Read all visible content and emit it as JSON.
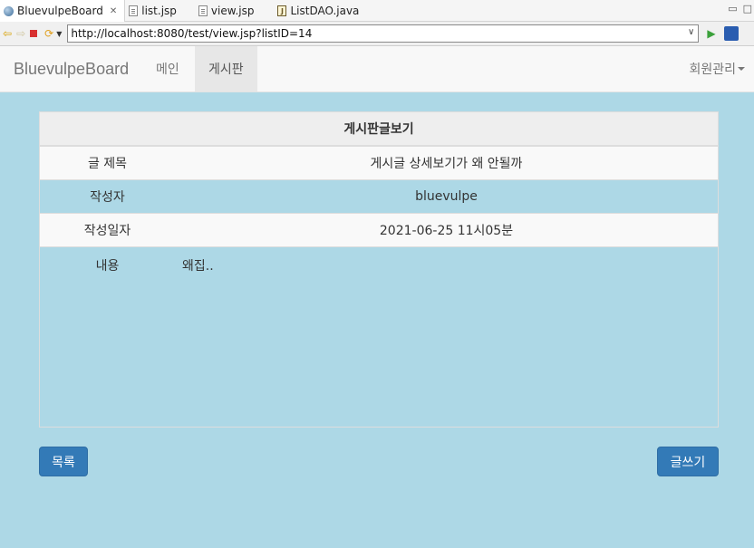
{
  "tabs": [
    {
      "label": "BluevulpeBoard",
      "close": "✕",
      "icon": "globe-icon"
    },
    {
      "label": "list.jsp",
      "icon": "jsp-file-icon"
    },
    {
      "label": "view.jsp",
      "icon": "jsp-file-icon"
    },
    {
      "label": "ListDAO.java",
      "icon": "java-file-icon"
    }
  ],
  "window_controls": {
    "minimize": "▭",
    "maximize": "□"
  },
  "toolbar": {
    "url": "http://localhost:8080/test/view.jsp?listID=14",
    "back": "⇦",
    "forward": "⇨",
    "refresh": "⟳",
    "go": "▶",
    "dropdown": "▼",
    "url_dropdown": "∨"
  },
  "navbar": {
    "brand": "BluevulpeBoard",
    "items": [
      {
        "label": "메인"
      },
      {
        "label": "게시판",
        "active": true
      }
    ],
    "right_menu": "회원관리"
  },
  "board": {
    "heading": "게시판글보기",
    "rows": [
      {
        "label": "글 제목",
        "value": "게시글 상세보기가 왜 안될까"
      },
      {
        "label": "작성자",
        "value": "bluevulpe"
      },
      {
        "label": "작성일자",
        "value": "2021-06-25 11시05분"
      }
    ],
    "content_label": "내용",
    "content_text": "왜집.."
  },
  "buttons": {
    "list": "목록",
    "write": "글쓰기"
  },
  "colors": {
    "page_bg": "#add8e6",
    "primary_button": "#337ab7",
    "navbar_bg": "#f8f8f8"
  }
}
